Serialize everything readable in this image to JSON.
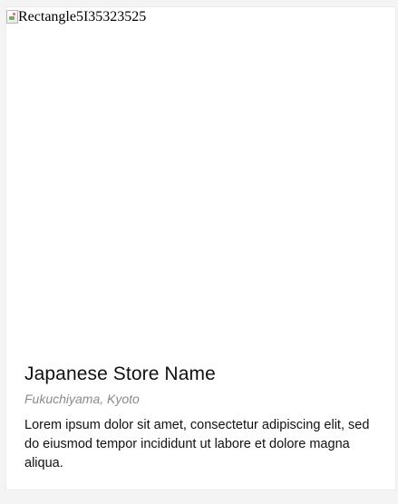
{
  "card": {
    "image_alt": "Rectangle5I35323525",
    "store_name": "Japanese Store Name",
    "location": "Fukuchiyama, Kyoto",
    "description": "Lorem ipsum dolor sit amet, consectetur adipiscing elit, sed do eiusmod tempor incididunt ut labore et dolore magna aliqua."
  },
  "icons": {
    "broken_image": "broken-image-icon"
  },
  "colors": {
    "card_background": "#ffffff",
    "page_background": "#f4f4f4",
    "title_text": "#111111",
    "location_text": "#8a8a8a"
  }
}
